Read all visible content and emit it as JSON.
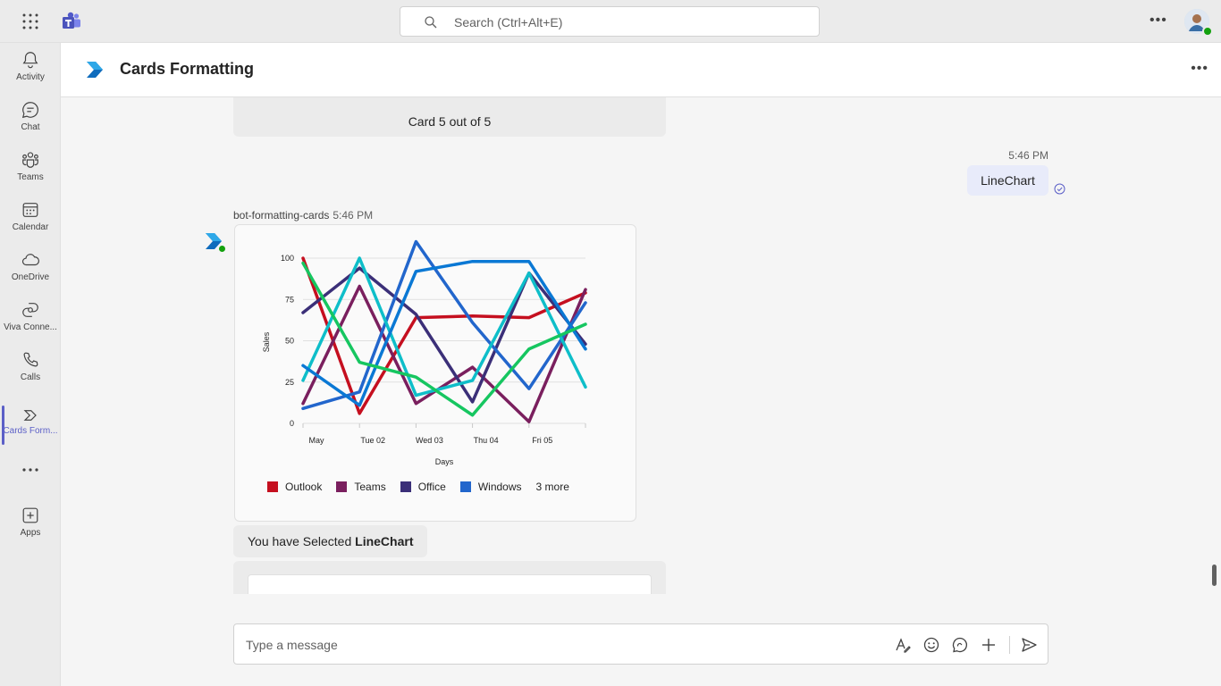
{
  "topbar": {
    "search_placeholder": "Search (Ctrl+Alt+E)"
  },
  "rail": {
    "items": [
      {
        "label": "Activity",
        "icon": "bell-icon"
      },
      {
        "label": "Chat",
        "icon": "chat-icon"
      },
      {
        "label": "Teams",
        "icon": "teams-icon"
      },
      {
        "label": "Calendar",
        "icon": "calendar-icon"
      },
      {
        "label": "OneDrive",
        "icon": "cloud-icon"
      },
      {
        "label": "Viva Conne...",
        "icon": "viva-connections-icon"
      },
      {
        "label": "Calls",
        "icon": "phone-icon"
      },
      {
        "label": "Cards Form...",
        "icon": "cards-formatting-icon"
      },
      {
        "label": "Apps",
        "icon": "add-apps-icon"
      }
    ]
  },
  "header": {
    "title": "Cards Formatting"
  },
  "chat": {
    "carousel_card_text": "Card 5 out of 5",
    "my_message": {
      "time": "5:46 PM",
      "text": "LineChart"
    },
    "bot_message": {
      "sender": "bot-formatting-cards",
      "time": "5:46 PM"
    },
    "selection_prefix": "You have Selected ",
    "selection_value": "LineChart"
  },
  "compose": {
    "placeholder": "Type a message"
  },
  "chart_data": {
    "type": "line",
    "xlabel": "Days",
    "ylabel": "Sales",
    "ylim": [
      0,
      100
    ],
    "yticks": [
      0,
      25,
      50,
      75,
      100
    ],
    "x_tick_labels": [
      "May",
      "Tue 02",
      "Wed 03",
      "Thu 04",
      "Fri 05"
    ],
    "x_points": 6,
    "legend_more": "3 more",
    "series": [
      {
        "name": "Outlook",
        "color": "#c50f1f",
        "values": [
          100,
          6,
          64,
          65,
          64,
          79
        ]
      },
      {
        "name": "Teams",
        "color": "#7a1f5e",
        "values": [
          12,
          83,
          12,
          34,
          1,
          81
        ]
      },
      {
        "name": "Office",
        "color": "#3b2f78",
        "values": [
          67,
          94,
          66,
          13,
          91,
          48
        ]
      },
      {
        "name": "Windows",
        "color": "#2266cc",
        "values": [
          9,
          19,
          110,
          61,
          21,
          73
        ]
      },
      {
        "color": "#0ebec9",
        "values": [
          26,
          100,
          17,
          26,
          91,
          22
        ]
      },
      {
        "color": "#0a78d4",
        "values": [
          35,
          11,
          92,
          98,
          98,
          45
        ]
      },
      {
        "color": "#16c660",
        "values": [
          97,
          37,
          28,
          5,
          45,
          60
        ]
      }
    ]
  }
}
